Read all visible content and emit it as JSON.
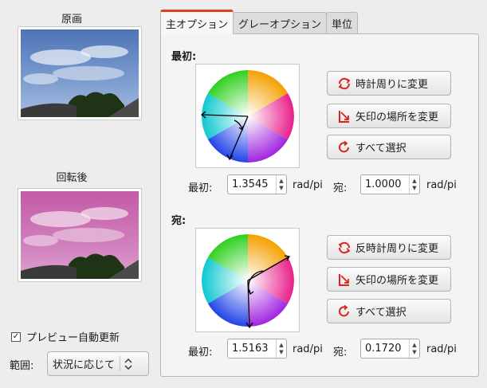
{
  "preview": {
    "original_label": "原画",
    "rotated_label": "回転後",
    "auto_update_label": "プレビュー自動更新",
    "auto_update_checked": true,
    "range_label": "範囲:",
    "range_value": "状況に応じて"
  },
  "tabs": [
    {
      "label": "主オプション",
      "active": true
    },
    {
      "label": "グレーオプション",
      "active": false
    },
    {
      "label": "単位",
      "active": false
    }
  ],
  "from": {
    "title": "最初:",
    "buttons": {
      "clockwise": "時計周りに変更",
      "swap": "矢印の場所を変更",
      "select_all": "すべて選択"
    },
    "first_label": "最初:",
    "first_value": "1.3545",
    "first_unit": "rad/pi",
    "to_label": "宛:",
    "to_value": "1.0000",
    "to_unit": "rad/pi"
  },
  "to": {
    "title": "宛:",
    "buttons": {
      "counterclockwise": "反時計周りに変更",
      "swap": "矢印の場所を変更",
      "select_all": "すべて選択"
    },
    "first_label": "最初:",
    "first_value": "1.5163",
    "first_unit": "rad/pi",
    "to_label": "宛:",
    "to_value": "0.1720",
    "to_unit": "rad/pi"
  },
  "icons": {
    "rotate": "rotate-arrows-icon",
    "swap": "swap-arrows-icon",
    "select_all": "refresh-icon"
  },
  "colors": {
    "accent": "#e2401a",
    "icon_red": "#d8241a"
  }
}
